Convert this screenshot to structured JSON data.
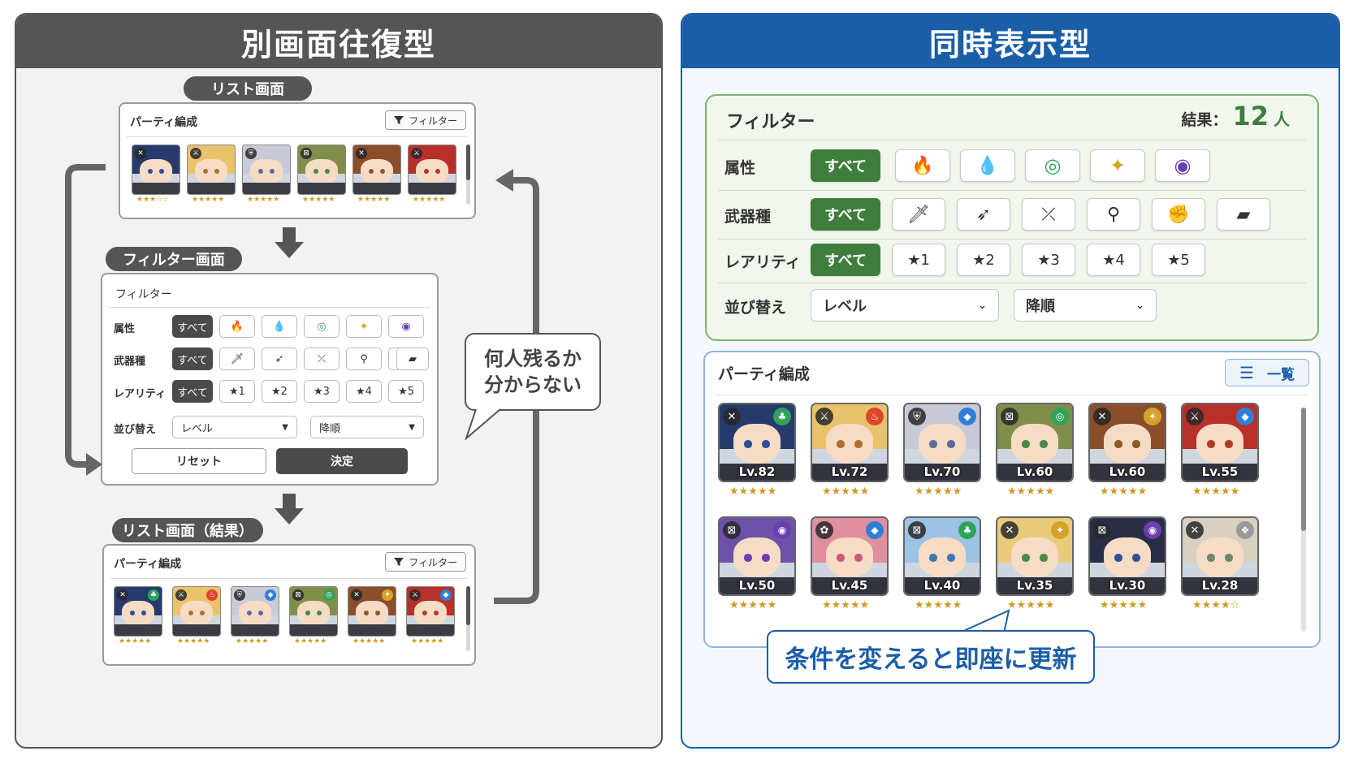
{
  "left": {
    "title": "別画面往復型",
    "list_pill": "リスト画面",
    "filter_pill": "フィルター画面",
    "result_pill": "リスト画面（結果）",
    "party_label": "パーティ編成",
    "filter_button": "フィルター",
    "filter_card_title": "フィルター",
    "row_attribute": "属性",
    "row_weapon": "武器種",
    "row_rarity": "レアリティ",
    "row_sort": "並び替え",
    "all": "すべて",
    "rarity_options": [
      "★1",
      "★2",
      "★3",
      "★4",
      "★5"
    ],
    "sort_value": "レベル",
    "order_value": "降順",
    "reset": "リセット",
    "confirm": "決定",
    "speech_line1": "何人残るか",
    "speech_line2": "分からない",
    "list_stars": [
      "★★★☆☆",
      "★★★★★",
      "★★★★★",
      "★★★★★",
      "★★★★★",
      "★★★★★"
    ],
    "result_stars": [
      "★★★★★",
      "★★★★★",
      "★★★★★",
      "★★★★★",
      "★★★★★",
      "★★★★★"
    ]
  },
  "right": {
    "title": "同時表示型",
    "filter_title": "フィルター",
    "result_label": "結果：",
    "result_count": "12",
    "result_unit": "人",
    "row_attribute": "属性",
    "row_weapon": "武器種",
    "row_rarity": "レアリティ",
    "row_sort": "並び替え",
    "all": "すべて",
    "rarity_options": [
      "★1",
      "★2",
      "★3",
      "★4",
      "★5"
    ],
    "sort_value": "レベル",
    "order_value": "降順",
    "party_label": "パーティ編成",
    "list_button": "一覧",
    "characters": [
      {
        "level": "Lv.82",
        "stars": "★★★★★"
      },
      {
        "level": "Lv.72",
        "stars": "★★★★★"
      },
      {
        "level": "Lv.70",
        "stars": "★★★★★"
      },
      {
        "level": "Lv.60",
        "stars": "★★★★★"
      },
      {
        "level": "Lv.60",
        "stars": "★★★★★"
      },
      {
        "level": "Lv.55",
        "stars": "★★★★★"
      },
      {
        "level": "Lv.50",
        "stars": "★★★★★"
      },
      {
        "level": "Lv.45",
        "stars": "★★★★★"
      },
      {
        "level": "Lv.40",
        "stars": "★★★★★"
      },
      {
        "level": "Lv.35",
        "stars": "★★★★★"
      },
      {
        "level": "Lv.30",
        "stars": "★★★★★"
      },
      {
        "level": "Lv.28",
        "stars": "★★★★☆"
      }
    ],
    "callout": "条件を変えると即座に更新"
  },
  "colors": {
    "left_accent": "#555555",
    "right_accent": "#1b5ea8",
    "filter_green": "#3f7d3c",
    "star_gold": "#d29a1e",
    "fire": "#e0452b",
    "water": "#2f7fd6",
    "wind": "#2fa35a",
    "light": "#d7a22a",
    "dark": "#6b3fb2"
  }
}
